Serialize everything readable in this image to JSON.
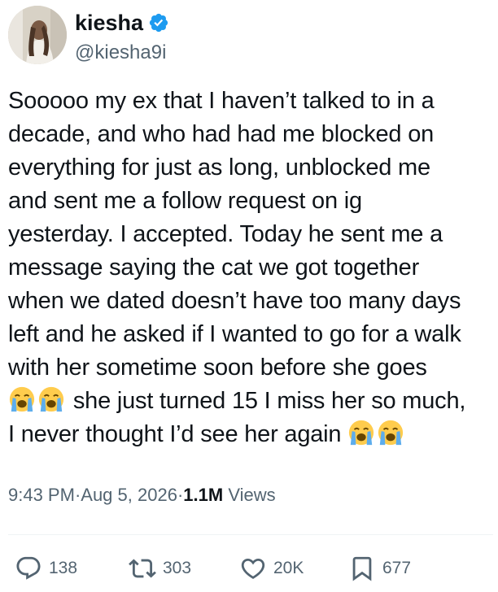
{
  "author": {
    "name": "kiesha",
    "handle": "@kiesha9i",
    "verified": true
  },
  "tweet": {
    "lines": [
      "Sooooo my ex that I haven’t talked to in a",
      "decade, and who had had me blocked on",
      "everything for just as long, unblocked me",
      "and sent me a follow request on ig",
      "yesterday. I accepted. Today he sent me a",
      "message saying the cat we got together",
      "when we dated doesn’t have too many days",
      "left and he asked if I wanted to go for a walk",
      "with her sometime soon before she goes"
    ],
    "line10_text": " she just turned 15 I miss her so much,",
    "line11_text": "I never thought I’d see her again ",
    "emoji_name": "loudly-crying-face-emoji"
  },
  "meta": {
    "time": "9:43 PM",
    "separator": " · ",
    "date": "Aug 5, 2026",
    "views_count": "1.1M",
    "views_label": "Views"
  },
  "actions": {
    "replies": "138",
    "reposts": "303",
    "likes": "20K",
    "bookmarks": "677"
  },
  "colors": {
    "text": "#0f1419",
    "secondary": "#536471",
    "verified_badge": "#1d9bf0",
    "divider": "#eff3f4"
  }
}
